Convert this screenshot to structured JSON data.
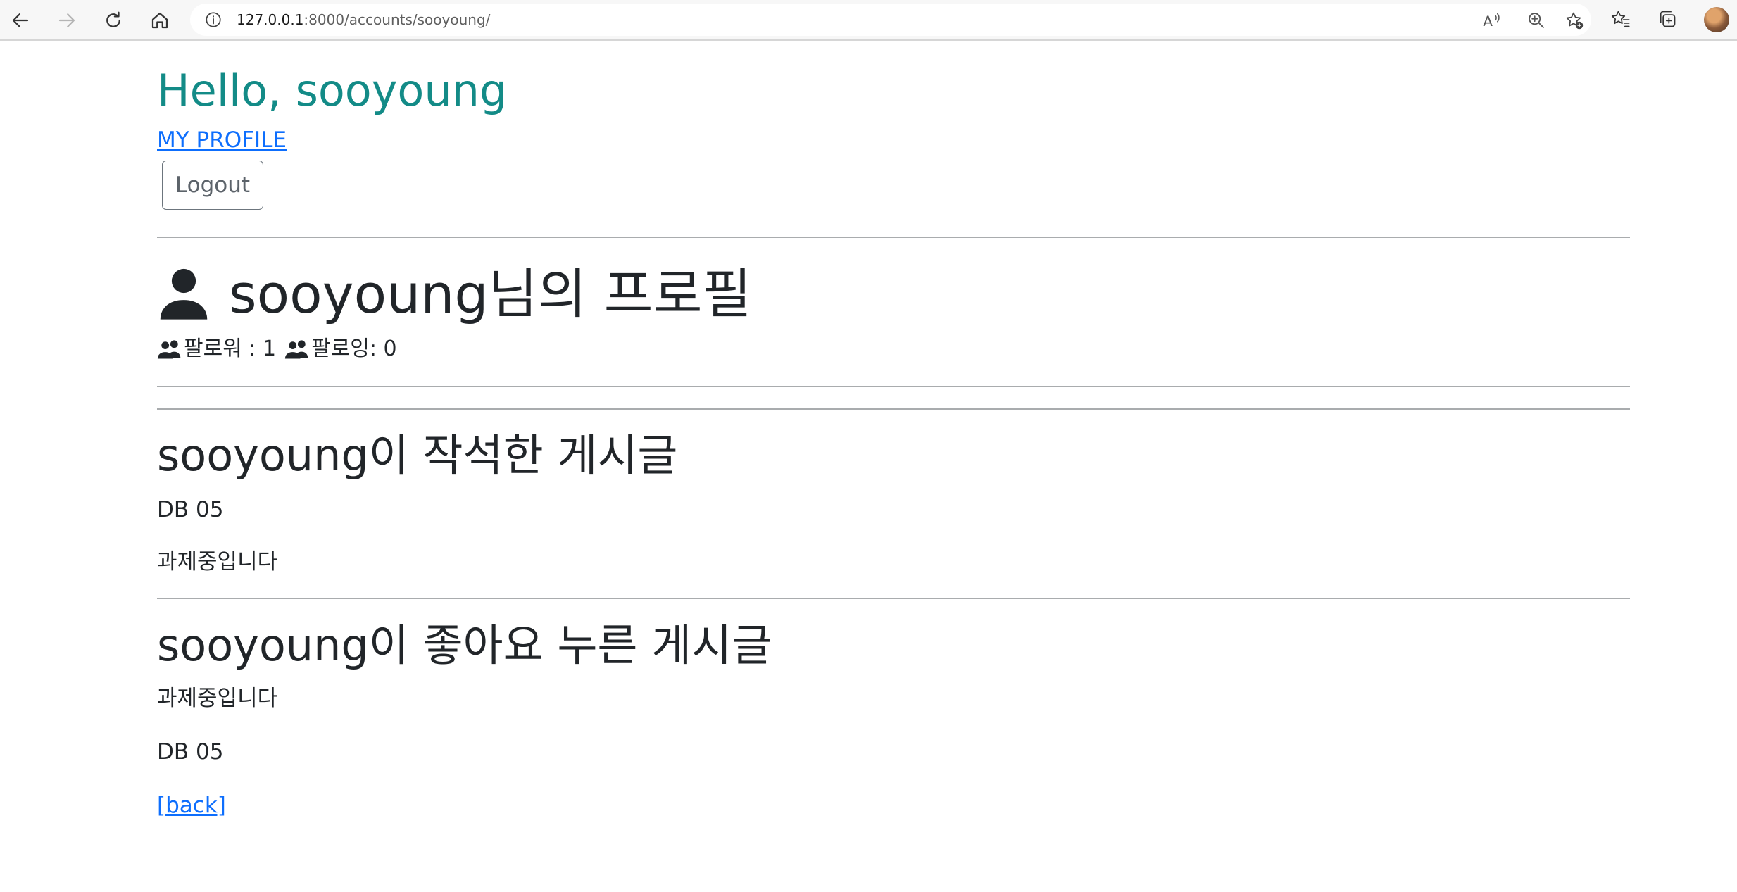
{
  "browser": {
    "url_host": "127.0.0.1",
    "url_path": ":8000/accounts/sooyoung/",
    "nav_icons": [
      "back-arrow-icon",
      "forward-arrow-icon",
      "refresh-icon",
      "home-icon"
    ],
    "toolbar_icons": [
      "read-aloud-icon",
      "zoom-icon",
      "add-favorite-icon",
      "favorites-icon",
      "collections-icon",
      "profile-avatar"
    ]
  },
  "header": {
    "greeting": "Hello, sooyoung",
    "greeting_color": "#138b87",
    "my_profile_link": "MY PROFILE",
    "logout_button": "Logout"
  },
  "profile": {
    "icon": "person-icon",
    "title": "sooyoung님의 프로필",
    "followers_label": "팔로워 : 1",
    "following_label": "팔로잉: 0",
    "follow_icon": "people-icon"
  },
  "written_section": {
    "title": "sooyoung이 작석한 게시글",
    "posts": [
      "DB 05",
      "과제중입니다"
    ]
  },
  "liked_section": {
    "title": "sooyoung이 좋아요 누른 게시글",
    "posts": [
      "과제중입니다",
      "DB 05"
    ]
  },
  "footer": {
    "back_link": "[back]"
  },
  "colors": {
    "link": "#0d6efd",
    "text": "#212529",
    "divider": "#a9acae"
  }
}
